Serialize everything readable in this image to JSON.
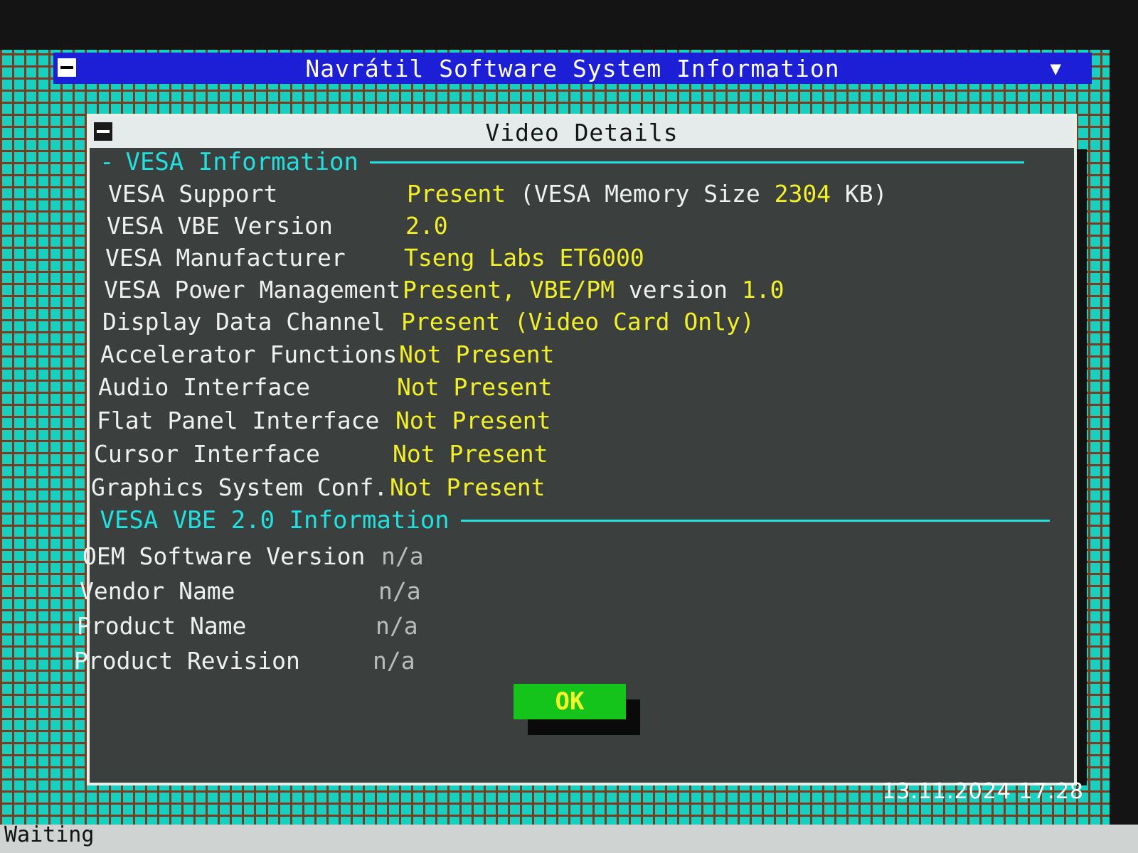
{
  "app": {
    "title": "Navrátil Software System Information",
    "scroll_arrow": "▼"
  },
  "dialog": {
    "title": "Video Details",
    "vesa_section": {
      "heading": "VESA Information",
      "rows": [
        {
          "label": "VESA Support",
          "value": "Present",
          "value_extra": " (VESA Memory Size ",
          "value_extra2": "2304",
          "value_extra3": " KB)"
        },
        {
          "label": "VESA VBE Version",
          "value": "2.0"
        },
        {
          "label": "VESA Manufacturer",
          "value": "Tseng Labs ET6000"
        },
        {
          "label": "VESA Power Management",
          "value": "Present, VBE/PM ",
          "value_extra": "version",
          "value_extra2": " 1.0"
        },
        {
          "label": "Display Data Channel",
          "value": "Present (Video Card Only)"
        },
        {
          "label": "Accelerator Functions",
          "value": "Not Present"
        },
        {
          "label": "Audio Interface",
          "value": "Not Present"
        },
        {
          "label": "Flat Panel Interface",
          "value": "Not Present"
        },
        {
          "label": "Cursor Interface",
          "value": "Not Present"
        },
        {
          "label": "Graphics System Conf.",
          "value": "Not Present"
        }
      ]
    },
    "vbe2_section": {
      "heading": "VESA VBE 2.0 Information",
      "rows": [
        {
          "label": "OEM Software Version",
          "value": "n/a"
        },
        {
          "label": "Vendor Name",
          "value": "n/a"
        },
        {
          "label": "Product Name",
          "value": "n/a"
        },
        {
          "label": "Product Revision",
          "value": "n/a"
        }
      ]
    },
    "ok_label": "OK"
  },
  "timestamp": "13.11.2024  17:28",
  "status": "Waiting"
}
